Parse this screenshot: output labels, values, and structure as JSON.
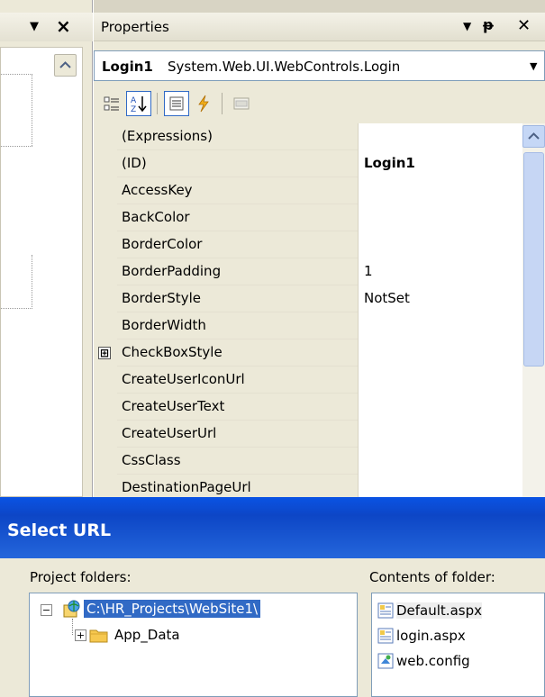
{
  "left_panel": {
    "pin_icon": "dropdown-arrow-icon",
    "close_icon": "close-icon"
  },
  "properties": {
    "title": "Properties",
    "object_name": "Login1",
    "object_type": "System.Web.UI.WebControls.Login",
    "toolbar": {
      "buttons": [
        "categorized-icon",
        "alphabetical-icon",
        "properties-icon",
        "events-icon",
        "property-pages-icon"
      ]
    },
    "rows": [
      {
        "name": "(Expressions)",
        "value": ""
      },
      {
        "name": "(ID)",
        "value": "Login1"
      },
      {
        "name": "AccessKey",
        "value": ""
      },
      {
        "name": "BackColor",
        "value": ""
      },
      {
        "name": "BorderColor",
        "value": ""
      },
      {
        "name": "BorderPadding",
        "value": "1"
      },
      {
        "name": "BorderStyle",
        "value": "NotSet"
      },
      {
        "name": "BorderWidth",
        "value": ""
      },
      {
        "name": "CheckBoxStyle",
        "value": ""
      },
      {
        "name": "CreateUserIconUrl",
        "value": ""
      },
      {
        "name": "CreateUserText",
        "value": ""
      },
      {
        "name": "CreateUserUrl",
        "value": ""
      },
      {
        "name": "CssClass",
        "value": ""
      },
      {
        "name": "DestinationPageUrl",
        "value": ""
      }
    ],
    "expander_symbol": "⊞"
  },
  "dialog": {
    "title": "Select URL",
    "project_folders_label": "Project folders:",
    "contents_label": "Contents of folder:",
    "tree": {
      "root": "C:\\HR_Projects\\WebSite1\\",
      "children": [
        "App_Data"
      ]
    },
    "files": [
      "Default.aspx",
      "login.aspx",
      "web.config"
    ],
    "toggle_minus": "−",
    "toggle_plus": "+"
  },
  "colors": {
    "selection": "#316ac5",
    "dialog_title": "#0d46c6",
    "chrome": "#ece9d8"
  }
}
